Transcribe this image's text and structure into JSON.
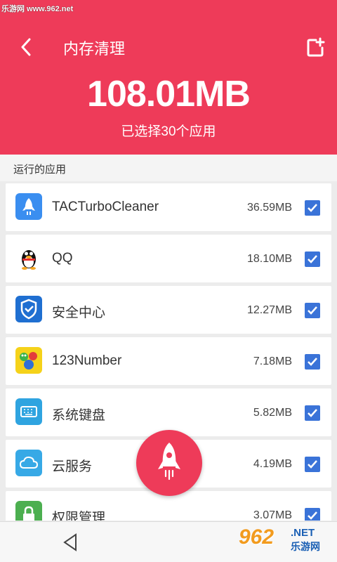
{
  "watermark": {
    "top_left": "乐游网 www.962.net",
    "bottom_right_num": "962",
    "bottom_right_net": ".NET",
    "bottom_right_sub": "乐游网"
  },
  "header": {
    "title": "内存清理",
    "total_size": "108.01MB",
    "selected_text": "已选择30个应用",
    "background": "#ee3b59"
  },
  "section": {
    "label": "运行的应用"
  },
  "apps": [
    {
      "name": "TACTurboCleaner",
      "size": "36.59MB",
      "icon": "rocket-icon",
      "checked": true
    },
    {
      "name": "QQ",
      "size": "18.10MB",
      "icon": "qq-penguin-icon",
      "checked": true
    },
    {
      "name": "安全中心",
      "size": "12.27MB",
      "icon": "shield-icon",
      "checked": true
    },
    {
      "name": "123Number",
      "size": "7.18MB",
      "icon": "number-game-icon",
      "checked": true
    },
    {
      "name": "系统键盘",
      "size": "5.82MB",
      "icon": "keyboard-icon",
      "checked": true
    },
    {
      "name": "云服务",
      "size": "4.19MB",
      "icon": "cloud-icon",
      "checked": true
    },
    {
      "name": "权限管理",
      "size": "3.07MB",
      "icon": "lock-icon",
      "checked": true
    }
  ],
  "colors": {
    "accent": "#ee3b59",
    "checkbox": "#3a73d8"
  }
}
